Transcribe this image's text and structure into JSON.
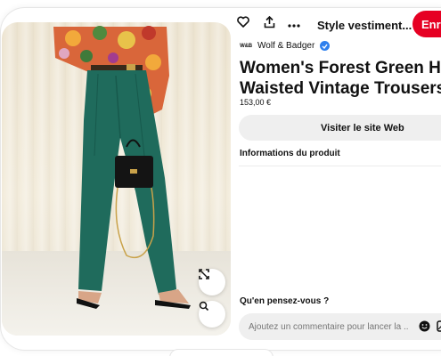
{
  "header": {
    "like_icon": "heart-icon",
    "share_icon": "share-upload-icon",
    "more_icon": "more-dots-icon",
    "board_name": "Style vestiment...",
    "board_chevron": "chevron-down-icon",
    "save_label": "Enreg"
  },
  "image": {
    "expand_icon": "expand-arrows-icon",
    "lens_icon": "visual-search-icon"
  },
  "merchant": {
    "logo_text": "W&B",
    "name": "Wolf & Badger",
    "verified_icon": "verified-check-icon"
  },
  "product": {
    "title_line1": "Women's Forest Green High-",
    "title_line2": "Waisted Vintage Trousers | Sug",
    "price": "153,00 €",
    "visit_label": "Visiter le site Web",
    "info_heading": "Informations du produit"
  },
  "comments": {
    "heading": "Qu'en pensez-vous ?",
    "placeholder": "Ajoutez un commentaire pour lancer la ...",
    "emoji_icon": "emoji-smile-icon",
    "image_icon": "image-attach-icon"
  },
  "colors": {
    "save_red": "#e60023",
    "trousers_green": "#1f6b5c",
    "verified_blue": "#2f80ed",
    "button_grey": "#efefef"
  }
}
